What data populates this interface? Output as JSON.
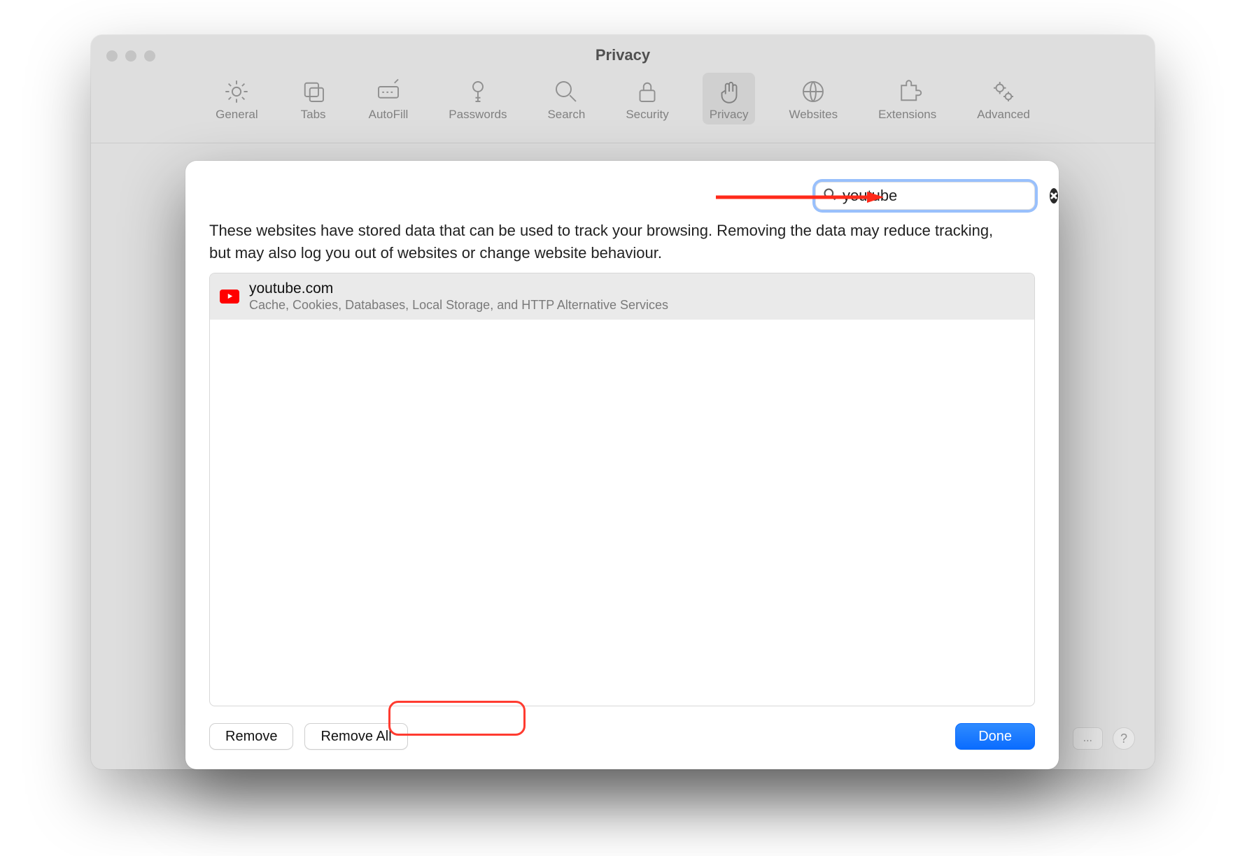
{
  "window": {
    "title": "Privacy",
    "tabs": [
      {
        "label": "General"
      },
      {
        "label": "Tabs"
      },
      {
        "label": "AutoFill"
      },
      {
        "label": "Passwords"
      },
      {
        "label": "Search"
      },
      {
        "label": "Security"
      },
      {
        "label": "Privacy"
      },
      {
        "label": "Websites"
      },
      {
        "label": "Extensions"
      },
      {
        "label": "Advanced"
      }
    ],
    "bottom": {
      "details": "...",
      "help": "?"
    }
  },
  "sheet": {
    "search_value": "youtube",
    "description": "These websites have stored data that can be used to track your browsing. Removing the data may reduce tracking, but may also log you out of websites or change website behaviour.",
    "sites": [
      {
        "name": "youtube.com",
        "detail": "Cache, Cookies, Databases, Local Storage, and HTTP Alternative Services"
      }
    ],
    "buttons": {
      "remove": "Remove",
      "remove_all": "Remove All",
      "done": "Done"
    }
  }
}
